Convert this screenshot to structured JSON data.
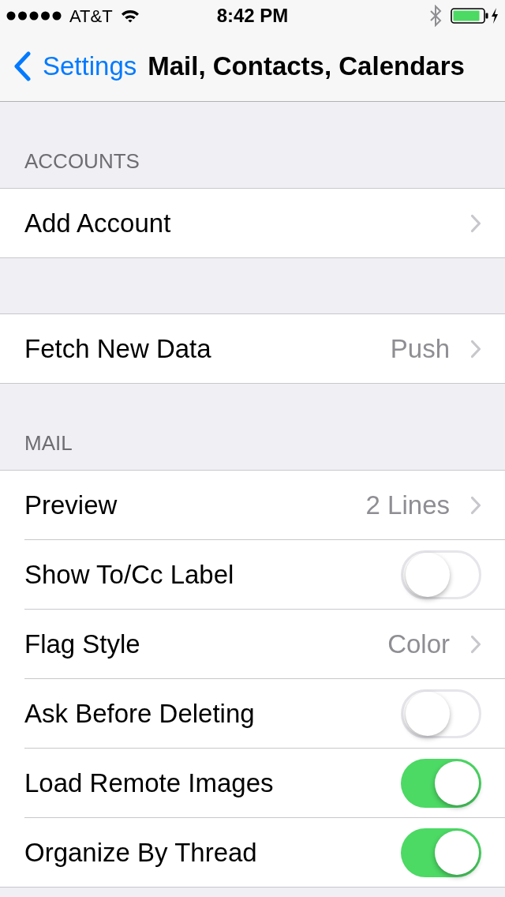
{
  "status_bar": {
    "carrier": "AT&T",
    "time": "8:42 PM"
  },
  "nav_bar": {
    "back_label": "Settings",
    "title": "Mail, Contacts, Calendars"
  },
  "sections": [
    {
      "header": "ACCOUNTS",
      "rows": [
        {
          "kind": "link",
          "label": "Add Account"
        }
      ]
    },
    {
      "rows": [
        {
          "kind": "link",
          "label": "Fetch New Data",
          "value": "Push"
        }
      ]
    },
    {
      "header": "MAIL",
      "rows": [
        {
          "kind": "link",
          "label": "Preview",
          "value": "2 Lines"
        },
        {
          "kind": "toggle",
          "label": "Show To/Cc Label",
          "on": false
        },
        {
          "kind": "link",
          "label": "Flag Style",
          "value": "Color"
        },
        {
          "kind": "toggle",
          "label": "Ask Before Deleting",
          "on": false
        },
        {
          "kind": "toggle",
          "label": "Load Remote Images",
          "on": true
        },
        {
          "kind": "toggle",
          "label": "Organize By Thread",
          "on": true
        }
      ]
    }
  ]
}
